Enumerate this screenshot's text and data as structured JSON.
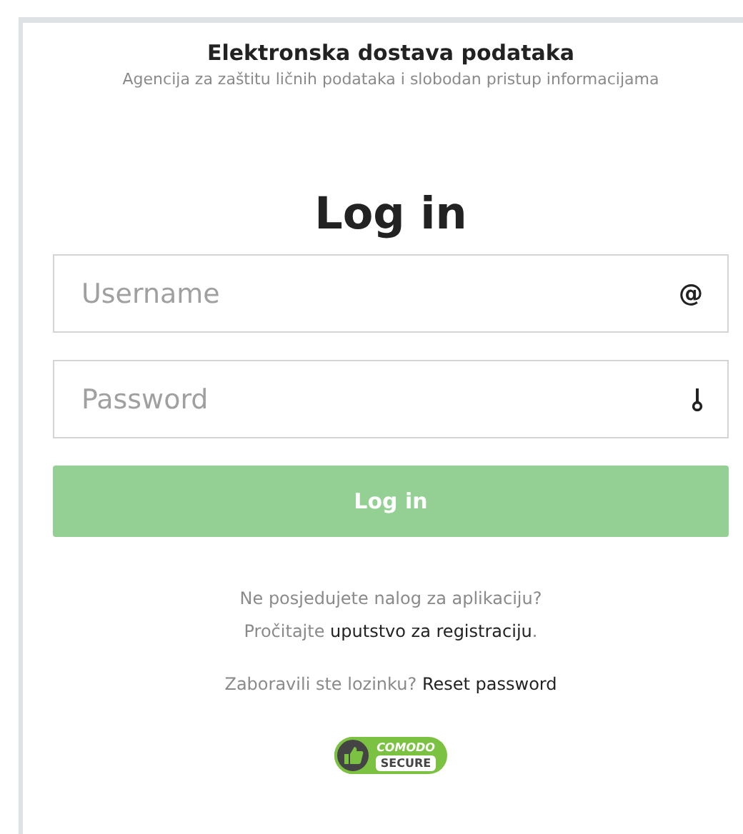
{
  "header": {
    "title": "Elektronska dostava podataka",
    "subtitle": "Agencija za zaštitu ličnih podataka i slobodan pristup informacijama"
  },
  "form": {
    "heading": "Log in",
    "username": {
      "placeholder": "Username",
      "icon_char": "@"
    },
    "password": {
      "placeholder": "Password"
    },
    "submit": "Log in"
  },
  "help": {
    "question": "Ne posjedujete nalog za aplikaciju?",
    "read_prefix": "Pročitajte",
    "read_link": "uputstvo za registraciju",
    "read_suffix": ".",
    "forgot": "Zaboravili ste lozinku?",
    "reset_link": "Reset password"
  },
  "badge": {
    "line_1": "COMODO",
    "line_2": "SECURE"
  }
}
